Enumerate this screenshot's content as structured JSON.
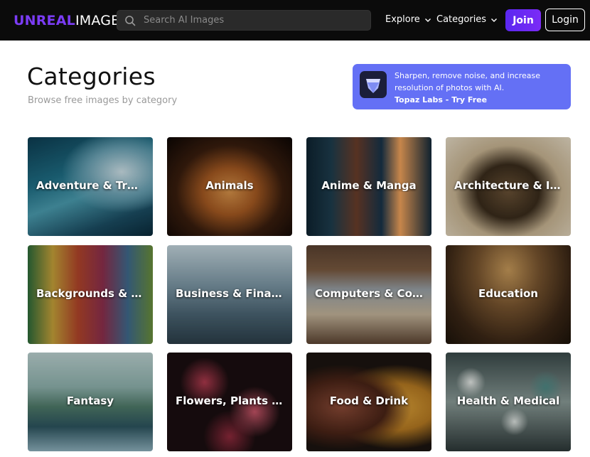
{
  "nav": {
    "logo_part1": "UNREAL",
    "logo_part2": "IMAGES",
    "search_placeholder": "Search AI Images",
    "explore_label": "Explore",
    "categories_label": "Categories",
    "join_label": "Join",
    "login_label": "Login"
  },
  "header": {
    "title": "Categories",
    "subtitle": "Browse free images by category"
  },
  "ad": {
    "text": "Sharpen, remove noise, and increase resolution of photos with AI.",
    "cta": "Topaz Labs - Try Free"
  },
  "categories": [
    {
      "label": "Adventure & Travel"
    },
    {
      "label": "Animals"
    },
    {
      "label": "Anime & Manga"
    },
    {
      "label": "Architecture & Interior"
    },
    {
      "label": "Backgrounds & Textures"
    },
    {
      "label": "Business & Finance"
    },
    {
      "label": "Computers & Code"
    },
    {
      "label": "Education"
    },
    {
      "label": "Fantasy"
    },
    {
      "label": "Flowers, Plants & Nature"
    },
    {
      "label": "Food & Drink"
    },
    {
      "label": "Health & Medical"
    }
  ],
  "colors": {
    "nav_bg": "#0b0b0b",
    "brand_purple": "#7b3cf5",
    "join_purple": "#6a2bf3",
    "ad_blue": "#6470f5"
  }
}
